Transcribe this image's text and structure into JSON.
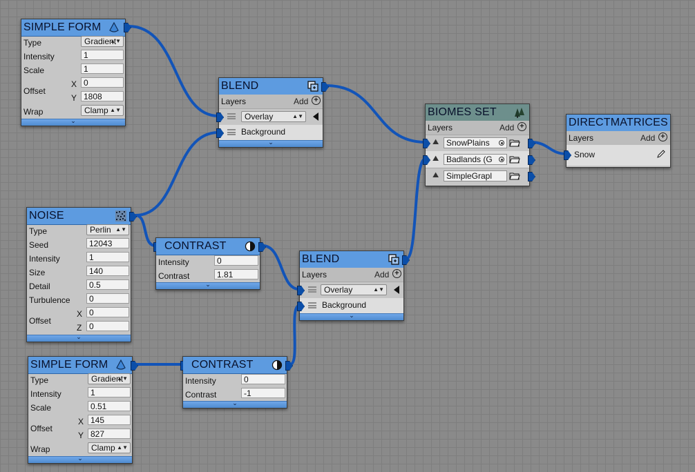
{
  "colors": {
    "wire": "#1254b8",
    "header": "#5d9be0",
    "header_biomes": "#6d8f8c",
    "body": "#c6c6c6"
  },
  "simple_form_1": {
    "title": "SIMPLE FORM",
    "icon": "cone-icon",
    "type_label": "Type",
    "type_value": "Gradient",
    "intensity_label": "Intensity",
    "intensity_value": "1",
    "scale_label": "Scale",
    "scale_value": "1",
    "offset_label": "Offset",
    "x_label": "X",
    "x_value": "0",
    "y_label": "Y",
    "y_value": "1808",
    "wrap_label": "Wrap",
    "wrap_value": "Clamp"
  },
  "blend_1": {
    "title": "BLEND",
    "icon": "blend-icon",
    "layers_label": "Layers",
    "add_label": "Add",
    "layers": [
      {
        "mode": "Overlay"
      },
      {
        "name": "Background"
      }
    ]
  },
  "biomes_set": {
    "title": "BIOMES SET",
    "icon": "trees-icon",
    "layers_label": "Layers",
    "add_label": "Add",
    "layers": [
      {
        "name": "SnowPlains"
      },
      {
        "name": "Badlands (G"
      },
      {
        "name": "SimpleGrapl"
      }
    ]
  },
  "direct_matrices": {
    "title": "DIRECTMATRICES",
    "layers_label": "Layers",
    "add_label": "Add",
    "layers": [
      {
        "name": "Snow"
      }
    ]
  },
  "noise": {
    "title": "NOISE",
    "icon": "noise-icon",
    "type_label": "Type",
    "type_value": "Perlin",
    "seed_label": "Seed",
    "seed_value": "12043",
    "intensity_label": "Intensity",
    "intensity_value": "1",
    "size_label": "Size",
    "size_value": "140",
    "detail_label": "Detail",
    "detail_value": "0.5",
    "turbulence_label": "Turbulence",
    "turbulence_value": "0",
    "offset_label": "Offset",
    "x_label": "X",
    "x_value": "0",
    "z_label": "Z",
    "z_value": "0"
  },
  "contrast_1": {
    "title": "CONTRAST",
    "icon": "contrast-icon",
    "intensity_label": "Intensity",
    "intensity_value": "0",
    "contrast_label": "Contrast",
    "contrast_value": "1.81"
  },
  "blend_2": {
    "title": "BLEND",
    "icon": "blend-icon",
    "layers_label": "Layers",
    "add_label": "Add",
    "layers": [
      {
        "mode": "Overlay"
      },
      {
        "name": "Background"
      }
    ]
  },
  "simple_form_2": {
    "title": "SIMPLE FORM",
    "icon": "cone-icon",
    "type_label": "Type",
    "type_value": "Gradient",
    "intensity_label": "Intensity",
    "intensity_value": "1",
    "scale_label": "Scale",
    "scale_value": "0.51",
    "offset_label": "Offset",
    "x_label": "X",
    "x_value": "145",
    "y_label": "Y",
    "y_value": "827",
    "wrap_label": "Wrap",
    "wrap_value": "Clamp"
  },
  "contrast_2": {
    "title": "CONTRAST",
    "icon": "contrast-icon",
    "intensity_label": "Intensity",
    "intensity_value": "0",
    "contrast_label": "Contrast",
    "contrast_value": "-1"
  }
}
